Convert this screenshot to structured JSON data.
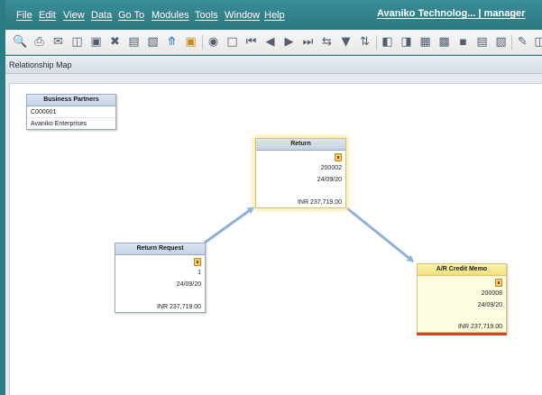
{
  "menu": {
    "file": "File",
    "edit": "Edit",
    "view": "View",
    "data": "Data",
    "goto": "Go To",
    "modules": "Modules",
    "tools": "Tools",
    "window": "Window",
    "help": "Help",
    "user": "Avaniko Technolog... | manager"
  },
  "window": {
    "title": "Relationship Map"
  },
  "toolbar_icons": [
    "print-preview-icon",
    "print-icon",
    "email-icon",
    "export-icon",
    "save-icon",
    "excel-icon",
    "word-icon",
    "pdf-icon",
    "upload-icon",
    "lock-icon",
    "find-icon",
    "add-icon",
    "first-record-icon",
    "previous-record-icon",
    "next-record-icon",
    "last-record-icon",
    "refresh-icon",
    "filter-icon",
    "sort-icon",
    "base-document-icon",
    "target-document-icon",
    "settings-icon",
    "journal-icon",
    "layout-icon",
    "form-icon",
    "gross-profit-icon",
    "edit-icon",
    "relationship-icon"
  ],
  "nodes": {
    "business_partners": {
      "title": "Business Partners",
      "code": "C000001",
      "name": "Avaniko Enterprises"
    },
    "return": {
      "title": "Return",
      "doc_no": "200002",
      "date": "24/09/20",
      "amount": "INR 237,719.00"
    },
    "return_request": {
      "title": "Return Request",
      "doc_no": "1",
      "date": "24/09/20",
      "amount": "INR 237,719.00"
    },
    "ar_credit_memo": {
      "title": "A/R Credit Memo",
      "doc_no": "200008",
      "date": "24/09/20",
      "amount": "INR 237,719.00"
    }
  },
  "colors": {
    "arrow": "#8db0dd",
    "header": "#c3d2e6",
    "accent_red": "#e23a30",
    "highlight_yellow": "#f2df7c"
  }
}
